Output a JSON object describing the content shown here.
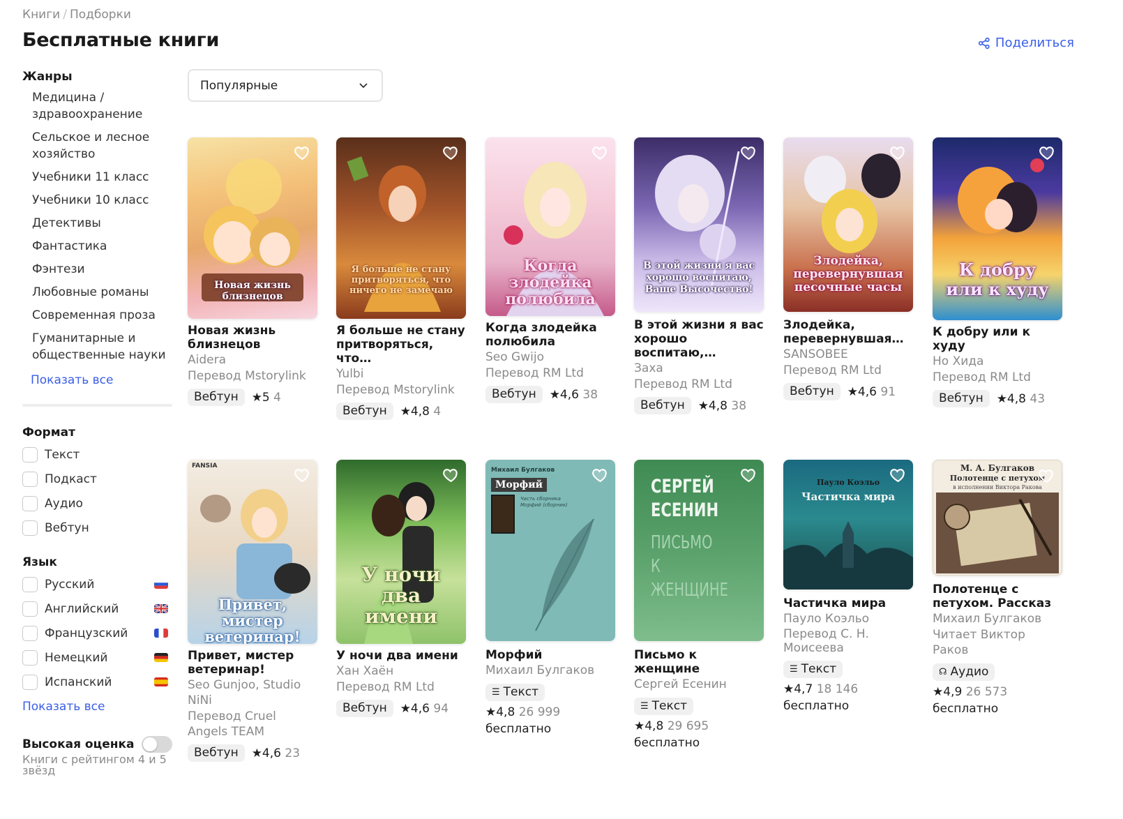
{
  "breadcrumb": {
    "root": "Книги",
    "separator": "/",
    "current": "Подборки"
  },
  "page_title": "Бесплатные книги",
  "share_label": "Поделиться",
  "sort": {
    "selected": "Популярные"
  },
  "sidebar": {
    "genres_heading": "Жанры",
    "genres": [
      "Медицина / здравоохранение",
      "Сельское и лесное хозяйство",
      "Учебники 11 класс",
      "Учебники 10 класс",
      "Детективы",
      "Фантастика",
      "Фэнтези",
      "Любовные романы",
      "Современная проза",
      "Гуманитарные и общественные науки"
    ],
    "genres_show_all": "Показать все",
    "format_heading": "Формат",
    "formats": [
      "Текст",
      "Подкаст",
      "Аудио",
      "Вебтун"
    ],
    "language_heading": "Язык",
    "languages": [
      {
        "label": "Русский",
        "flag": "ru-flag-icon"
      },
      {
        "label": "Английский",
        "flag": "uk-flag-icon"
      },
      {
        "label": "Французский",
        "flag": "fr-flag-icon"
      },
      {
        "label": "Немецкий",
        "flag": "de-flag-icon"
      },
      {
        "label": "Испанский",
        "flag": "es-flag-icon"
      }
    ],
    "languages_show_all": "Показать все",
    "high_rating_label": "Высокая оценка",
    "high_rating_sub": "Книги с рейтингом 4 и 5 звёзд"
  },
  "books": [
    {
      "title": "Новая жизнь близнецов",
      "author": "Aidera",
      "credit": "Перевод Mstorylink",
      "format": "Вебтун",
      "rating": "★5",
      "count": "4",
      "cover_text": "Новая жизнь близнецов"
    },
    {
      "title": "Я больше не стану притворяться, что…",
      "author": "Yulbi",
      "credit": "Перевод Mstorylink",
      "format": "Вебтун",
      "rating": "★4,8",
      "count": "4",
      "cover_text": "Я больше не стану притворяться, что ничего не замечаю"
    },
    {
      "title": "Когда злодейка полюбила",
      "author": "Seo Gwijo",
      "credit": "Перевод RM Ltd",
      "format": "Вебтун",
      "rating": "★4,6",
      "count": "38",
      "cover_text": "Когда злодейка полюбила"
    },
    {
      "title": "В этой жизни я вас хорошо воспитаю,…",
      "author": "Заха",
      "credit": "Перевод RM Ltd",
      "format": "Вебтун",
      "rating": "★4,8",
      "count": "38",
      "cover_text": "В этой жизни я вас хорошо воспитаю, Ваше Высочество!"
    },
    {
      "title": "Злодейка, перевернувшая…",
      "author": "SANSOBEE",
      "credit": "Перевод RM Ltd",
      "format": "Вебтун",
      "rating": "★4,6",
      "count": "91",
      "cover_text": "Злодейка, перевернувшая песочные часы"
    },
    {
      "title": "К добру или к худу",
      "author": "Но Хида",
      "credit": "Перевод RM Ltd",
      "format": "Вебтун",
      "rating": "★4,8",
      "count": "43",
      "cover_text": "К добру или к худу"
    },
    {
      "title": "Привет, мистер ветеринар!",
      "author": "Seo Gunjoo, Studio NiNi",
      "credit": "Перевод Cruel Angels TEAM",
      "format": "Вебтун",
      "rating": "★4,6",
      "count": "23",
      "cover_text": "Привет, мистер ветеринар!",
      "cover_brand": "FANSIA"
    },
    {
      "title": "У ночи два имени",
      "author": "Хан Хаён",
      "credit": "Перевод RM Ltd",
      "format": "Вебтун",
      "rating": "★4,6",
      "count": "94",
      "cover_text": "У ночи два имени"
    },
    {
      "title": "Морфий",
      "author": "Михаил Булгаков",
      "format": "Текст",
      "rating": "★4,8",
      "count": "26 999",
      "price": "бесплатно",
      "cover_author": "Михаил Булгаков",
      "cover_text": "Морфий",
      "cover_sub": "Часть сборника Морфий (сборник)"
    },
    {
      "title": "Письмо к женщине",
      "author": "Сергей Есенин",
      "format": "Текст",
      "rating": "★4,8",
      "count": "29 695",
      "price": "бесплатно",
      "cover_author": "СЕРГЕЙ ЕСЕНИН",
      "cover_text": "ПИСЬМО К ЖЕНЩИНЕ"
    },
    {
      "title": "Частичка мира",
      "author": "Пауло Коэльо",
      "credit": "Перевод С. Н. Моисеева",
      "format": "Текст",
      "rating": "★4,7",
      "count": "18 146",
      "price": "бесплатно",
      "cover_author": "Пауло Коэльо",
      "cover_text": "Частичка мира"
    },
    {
      "title": "Полотенце с петухом. Рассказ",
      "author": "Михаил Булгаков",
      "credit": "Читает Виктор Раков",
      "format": "Аудио",
      "rating": "★4,9",
      "count": "26 573",
      "price": "бесплатно",
      "cover_author": "М. А. Булгаков",
      "cover_text": "Полотенце с петухом",
      "cover_sub": "в исполнении Виктора Ракова"
    }
  ],
  "colors": {
    "accent": "#3a5ee8",
    "text": "#1f1f1f",
    "muted": "#8a8a8a",
    "badge_bg": "#f0f0f0"
  }
}
